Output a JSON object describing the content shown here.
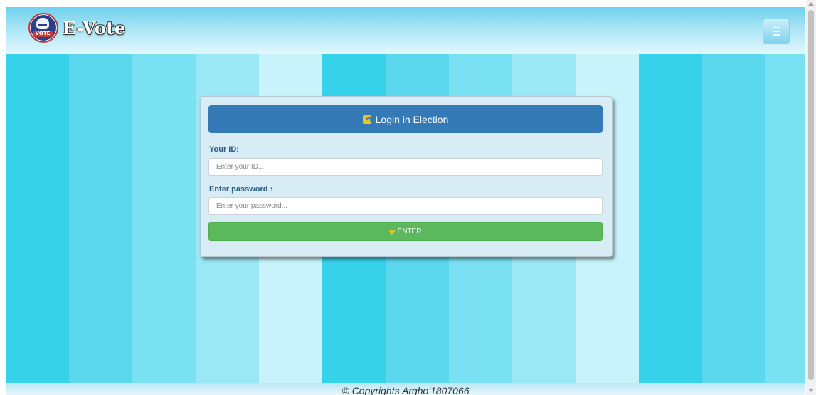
{
  "navbar": {
    "brand": "E-Vote",
    "logo_badge": "VOTE",
    "menu_icon": "hamburger-icon"
  },
  "background": {
    "stripe_colors": [
      "#36d2ea",
      "#5cd8ee",
      "#7ae1f2",
      "#9ae8f5",
      "#c9f3fb",
      "#36d2ea",
      "#5cd8ee",
      "#7ae1f2",
      "#9ae8f5",
      "#c9f3fb",
      "#36d2ea",
      "#5cd8ee",
      "#7ae1f2"
    ]
  },
  "login": {
    "title": "Login in Election",
    "title_icon": "login-icon",
    "id_label": "Your ID:",
    "id_placeholder": "Enter your ID...",
    "id_value": "",
    "password_label": "Enter password :",
    "password_placeholder": "Enter your password...",
    "password_value": "",
    "submit_label": "ENTER",
    "submit_icon": "send-icon"
  },
  "footer": {
    "text": "© Copyrights Argho'1807066"
  },
  "colors": {
    "header_blue": "#337ab7",
    "button_green": "#5cb85c",
    "icon_yellow": "#f0c419",
    "card_bg": "#d8ecf5"
  }
}
